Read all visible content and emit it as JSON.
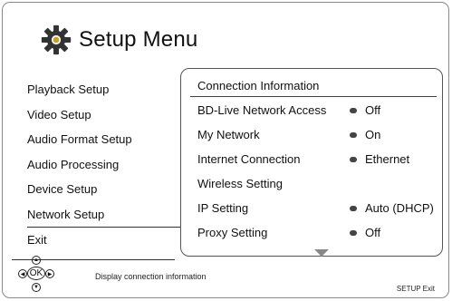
{
  "header": {
    "title": "Setup Menu",
    "icon": "gear-icon"
  },
  "left_menu": {
    "items": [
      {
        "label": "Playback Setup"
      },
      {
        "label": "Video Setup"
      },
      {
        "label": "Audio Format Setup"
      },
      {
        "label": "Audio Processing"
      },
      {
        "label": "Device Setup"
      },
      {
        "label": "Network Setup",
        "selected": true
      }
    ],
    "exit_label": "Exit"
  },
  "panel": {
    "title": "Connection Information",
    "rows": [
      {
        "label": "BD-Live Network Access",
        "value": "Off"
      },
      {
        "label": "My Network",
        "value": "On"
      },
      {
        "label": "Internet Connection",
        "value": "Ethernet"
      },
      {
        "label": "Wireless Setting",
        "value": ""
      },
      {
        "label": "IP Setting",
        "value": "Auto (DHCP)"
      },
      {
        "label": "Proxy Setting",
        "value": "Off"
      }
    ]
  },
  "footer": {
    "ok_label": "OK",
    "hint": "Display connection information",
    "setup_exit": "SETUP   Exit"
  }
}
